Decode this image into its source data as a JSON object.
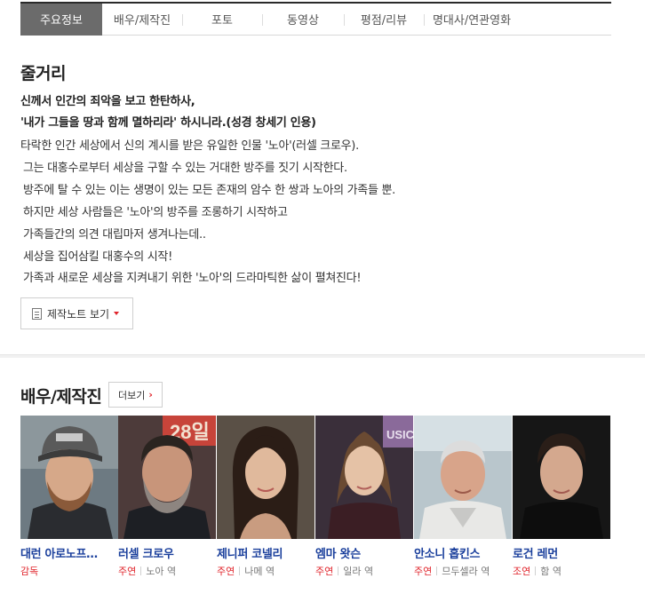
{
  "tabs": [
    {
      "label": "주요정보",
      "active": true
    },
    {
      "label": "배우/제작진",
      "active": false
    },
    {
      "label": "포토",
      "active": false
    },
    {
      "label": "동영상",
      "active": false
    },
    {
      "label": "평점/리뷰",
      "active": false
    },
    {
      "label": "명대사/연관영화",
      "active": false
    }
  ],
  "synopsis": {
    "title": "줄거리",
    "bold_lines": [
      "신께서 인간의 죄악을 보고 한탄하사,",
      "'내가 그들을 땅과 함께 멸하리라' 하시니라.(성경 창세기 인용)"
    ],
    "lines": [
      "타락한 인간 세상에서 신의 계시를 받은 유일한 인물 '노아'(러셀 크로우).",
      "그는 대홍수로부터 세상을 구할 수 있는 거대한 방주를 짓기 시작한다.",
      "방주에 탈 수 있는 이는 생명이 있는 모든 존재의 암수 한 쌍과 노아의 가족들 뿐.",
      "하지만 세상 사람들은 '노아'의 방주를 조롱하기 시작하고",
      "가족들간의 의견 대립마저 생겨나는데..",
      "세상을 집어삼킬 대홍수의 시작!",
      "가족과 새로운 세상을 지켜내기 위한 '노아'의 드라마틱한 삶이 펼쳐진다!"
    ],
    "note_button": "제작노트 보기"
  },
  "cast": {
    "title": "배우/제작진",
    "more_button": "더보기",
    "members": [
      {
        "name": "대런 아로노프…",
        "kind": "감독",
        "character": ""
      },
      {
        "name": "러셀 크로우",
        "kind": "주연",
        "character": "노아 역"
      },
      {
        "name": "제니퍼 코넬리",
        "kind": "주연",
        "character": "나메 역"
      },
      {
        "name": "엠마 왓슨",
        "kind": "주연",
        "character": "일라 역"
      },
      {
        "name": "안소니 홉킨스",
        "kind": "주연",
        "character": "므두셀라 역"
      },
      {
        "name": "로건 레먼",
        "kind": "조연",
        "character": "함 역"
      }
    ]
  },
  "colors": {
    "accent_red": "#e0242b",
    "name_blue": "#1a3f9c",
    "active_tab_bg": "#6b6b6b"
  }
}
